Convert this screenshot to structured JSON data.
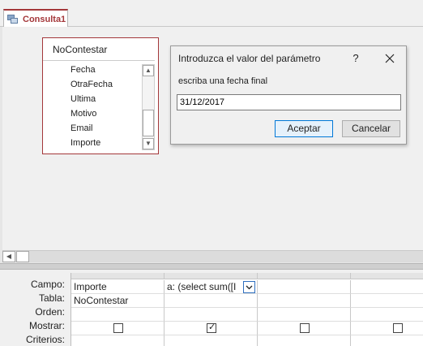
{
  "tab": {
    "label": "Consulta1"
  },
  "table": {
    "name": "NoContestar",
    "fields": [
      "Fecha",
      "OtraFecha",
      "Ultima",
      "Motivo",
      "Email",
      "Importe"
    ]
  },
  "dialog": {
    "title": "Introduzca el valor del parámetro",
    "help": "?",
    "prompt": "escriba una fecha final",
    "value": "31/12/2017",
    "ok_label": "Aceptar",
    "cancel_label": "Cancelar"
  },
  "grid": {
    "row_labels": [
      "Campo:",
      "Tabla:",
      "Orden:",
      "Mostrar:",
      "Criterios:"
    ],
    "columns": [
      {
        "campo": "Importe",
        "tabla": "NoContestar",
        "mostrar": false
      },
      {
        "campo": "a: (select sum([I",
        "tabla": "",
        "mostrar": true
      },
      {
        "campo": "",
        "tabla": "",
        "mostrar": false
      },
      {
        "campo": "",
        "tabla": "",
        "mostrar": false
      }
    ]
  },
  "colors": {
    "accent": "#a4373a",
    "focus": "#0078d7"
  }
}
